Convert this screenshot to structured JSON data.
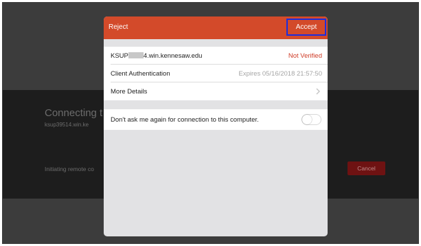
{
  "background": {
    "title": "Connecting t",
    "host": "ksup39514.win.ke",
    "status": "Initiating remote co",
    "cancel_label": "Cancel"
  },
  "sheet": {
    "reject_label": "Reject",
    "accept_label": "Accept",
    "rows": [
      {
        "label_prefix": "KSUP",
        "label_suffix": "4.win.kennesaw.edu",
        "value": "Not Verified"
      },
      {
        "label": "Client Authentication",
        "value": "Expires 05/16/2018 21:57:50"
      },
      {
        "label": "More Details"
      }
    ],
    "dont_ask_label": "Don't ask me again for connection to this computer.",
    "dont_ask_toggle_on": false
  },
  "colors": {
    "header": "#d34a2a",
    "not_verified": "#cf3a25",
    "highlight_box": "#1a2de0",
    "cancel_bg": "#6e1212"
  },
  "icons": [
    "chevron-right-icon",
    "toggle-switch"
  ]
}
